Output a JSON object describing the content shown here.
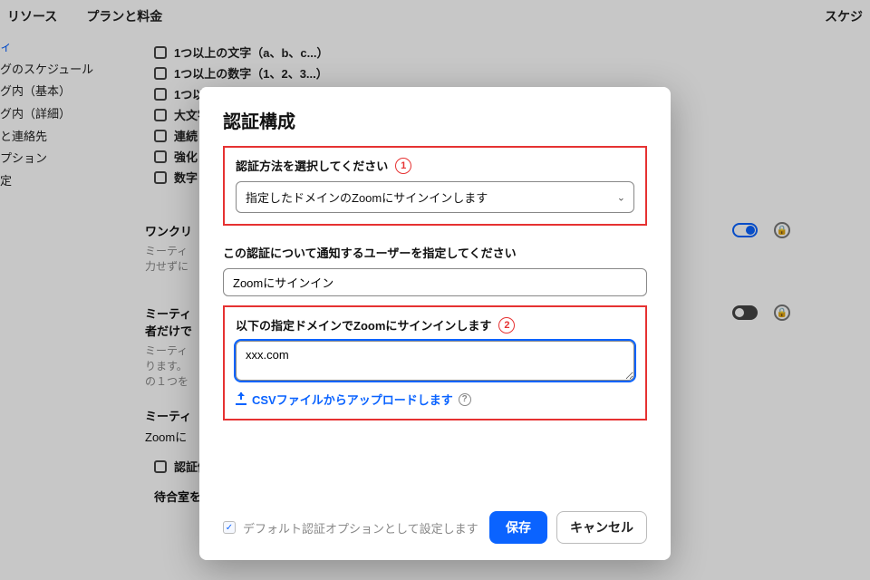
{
  "nav": {
    "left1": "リソース",
    "left2": "プランと料金",
    "right1": "スケジ"
  },
  "sidebar": {
    "items": [
      {
        "label": "ィ",
        "active": true
      },
      {
        "label": "グのスケジュール"
      },
      {
        "label": "グ内（基本）"
      },
      {
        "label": "グ内（詳細）"
      },
      {
        "label": "と連絡先"
      },
      {
        "label": ""
      },
      {
        "label": "プション"
      },
      {
        "label": "定"
      }
    ]
  },
  "bg_checks": {
    "c0": "1つ以上の文字（a、b、c...）",
    "c1": "1つ以上の数字（1、2、3...）",
    "c2": "1つ以",
    "c3": "大文字",
    "c4": "連続",
    "c5": "強化",
    "c6": "数字"
  },
  "bg_sections": {
    "oneclick_title": "ワンクリ",
    "oneclick_sub": "ミーティ\n力せずに",
    "auth_heading": "ミーティ\n者だけで",
    "auth_sub": "ミーティ\nります。\nの１つを",
    "mtg_title": "ミーティ",
    "mtg_sub": "Zoomに",
    "except_label": "認証例外を許可する",
    "waitroom": "待合室を有効にすると、電話のみのユーザーは待合室に配置されます。"
  },
  "modal": {
    "title": "認証構成",
    "sec1_label": "認証方法を選択してください",
    "annot1": "1",
    "select_value": "指定したドメインのZoomにサインインします",
    "sec2_label": "この認証について通知するユーザーを指定してください",
    "input2_value": "Zoomにサインイン",
    "sec3_label": "以下の指定ドメインでZoomにサインインします",
    "annot2": "2",
    "textarea_value": "xxx.com",
    "upload_link": "CSVファイルからアップロードします",
    "default_label": "デフォルト認証オプションとして設定します",
    "save": "保存",
    "cancel": "キャンセル"
  }
}
